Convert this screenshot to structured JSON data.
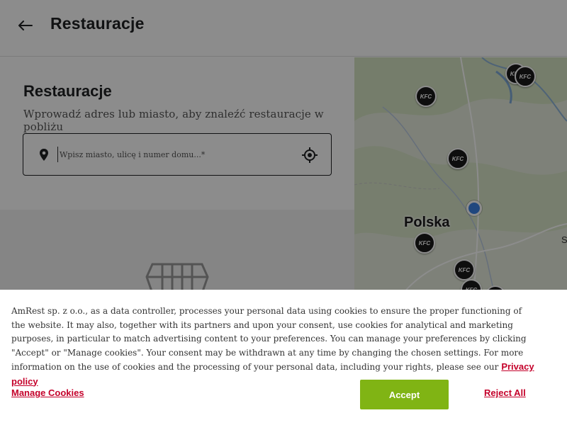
{
  "header": {
    "title": "Restauracje",
    "back_icon": "arrow-left-icon"
  },
  "search_panel": {
    "title": "Restauracje",
    "subtitle": "Wprowadź adres lub miasto, aby znaleźć restauracje w pobliżu",
    "input_placeholder": "Wpisz miasto, ulicę i numer domu...*",
    "input_value": "",
    "pin_icon": "location-pin-icon",
    "locate_icon": "crosshair-locate-icon"
  },
  "map": {
    "country_label": "Polska",
    "edge_label": "S",
    "marker_label": "KFC",
    "marker_color": "#1a1a1a",
    "user_dot_color": "#3b82e6"
  },
  "cookie_banner": {
    "text": "AmRest sp. z o.o., as a data controller, processes your personal data using cookies to ensure the proper functioning of the website. It may also, together with its partners and upon your consent, use cookies for analytical and marketing purposes, in particular to match advertising content to your preferences. You can manage your preferences by clicking \"Accept\" or \"Manage cookies\". Your consent may be withdrawn at any time by changing the chosen settings. For more information on the use of cookies and the processing of your personal data, including your rights, please see our",
    "privacy_link": "Privacy policy",
    "manage_label": "Manage Cookies",
    "accept_label": "Accept",
    "reject_label": "Reject All",
    "accent_color": "#c4002a",
    "accept_color": "#80b414"
  }
}
